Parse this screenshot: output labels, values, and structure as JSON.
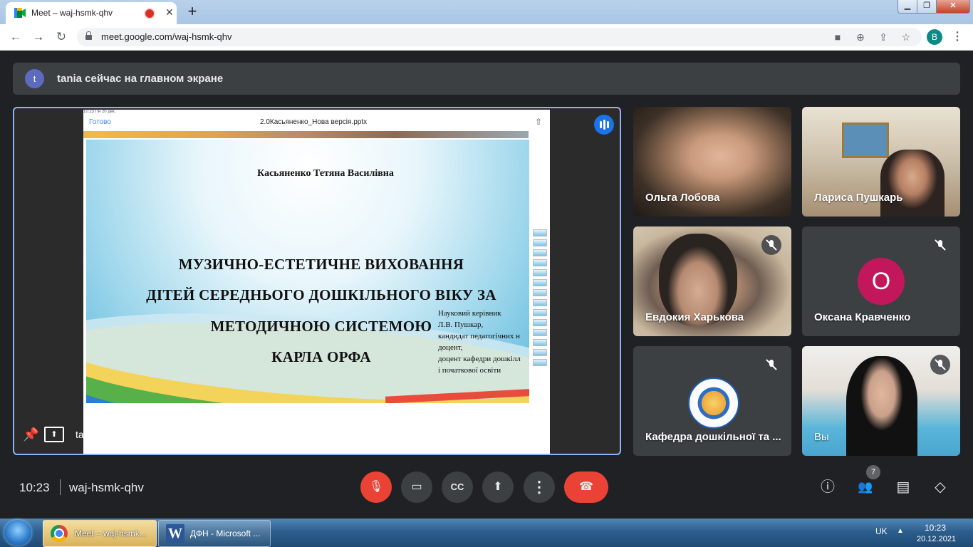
{
  "browser": {
    "tab_title": "Meet – waj-hsmk-qhv",
    "tab_close": "✕",
    "new_tab": "+",
    "url": "meet.google.com/waj-hsmk-qhv",
    "profile_initial": "B",
    "win_min": "▁",
    "win_max": "❐",
    "win_close": "✕",
    "nav": {
      "back": "←",
      "forward": "→",
      "reload": "↻"
    },
    "omni_icons": {
      "camera": "■",
      "zoom": "⊕",
      "share": "⇪",
      "star": "☆"
    },
    "menu": "⋮"
  },
  "banner": {
    "avatar_initial": "t",
    "text": "tania сейчас на главном экране"
  },
  "presentation": {
    "presenter_name": "tania",
    "phone_done": "Готово",
    "file_name": "2.0Касьяненко_Нова версія.pptx",
    "status_time": "10:23  Пн 20 дек.",
    "slide_author": "Касьяненко Тетяна Василівна",
    "slide_title_lines": [
      "МУЗИЧНО-ЕСТЕТИЧНЕ ВИХОВАННЯ",
      "ДІТЕЙ СЕРЕДНЬОГО ДОШКІЛЬНОГО ВІКУ ЗА",
      "МЕТОДИЧНОЮ СИСТЕМОЮ",
      "КАРЛА ОРФА"
    ],
    "supervisor_lines": [
      "Науковий керівник",
      "Л.В. Пушкар,",
      "кандидат педагогічних н",
      " доцент,",
      "доцент  кафедри дошкілл",
      "і початкової освіти"
    ]
  },
  "participants": [
    {
      "name": "Ольга Лобова",
      "muted": false
    },
    {
      "name": "Лариса Пушкарь",
      "muted": false
    },
    {
      "name": "Евдокия Харькова",
      "muted": true
    },
    {
      "name": "Оксана Кравченко",
      "muted": true,
      "avatar_letter": "О",
      "avatar_color": "#c2185b"
    },
    {
      "name": "Кафедра дошкільної та ...",
      "muted": true
    },
    {
      "name": "Вы",
      "muted": true
    }
  ],
  "bottom_bar": {
    "time": "10:23",
    "meeting_code": "waj-hsmk-qhv",
    "people_count": "7",
    "buttons": {
      "mic": "mic-off-icon",
      "camera": "videocam-icon",
      "captions": "closed-caption-icon",
      "present": "present-screen-icon",
      "more": "more-vert-icon",
      "leave": "call-end-icon"
    },
    "glyphs": {
      "mic": "🎙",
      "camera": "▭",
      "captions": "CC",
      "present": "⬆",
      "more": "⋮",
      "leave": "☎",
      "info": "ⓘ",
      "people": "👥",
      "chat": "▤",
      "activities": "◇"
    }
  },
  "taskbar": {
    "tasks": [
      {
        "label": "Meet – waj-hsmk..."
      },
      {
        "label": "ДФН - Microsoft ..."
      }
    ],
    "word_letter": "W",
    "language": "UK",
    "tray_arrow": "▲",
    "clock_time": "10:23",
    "clock_date": "20.12.2021"
  },
  "colors": {
    "meet_bg": "#202124",
    "accent_blue": "#8ab4f8",
    "danger_red": "#ea4335"
  }
}
